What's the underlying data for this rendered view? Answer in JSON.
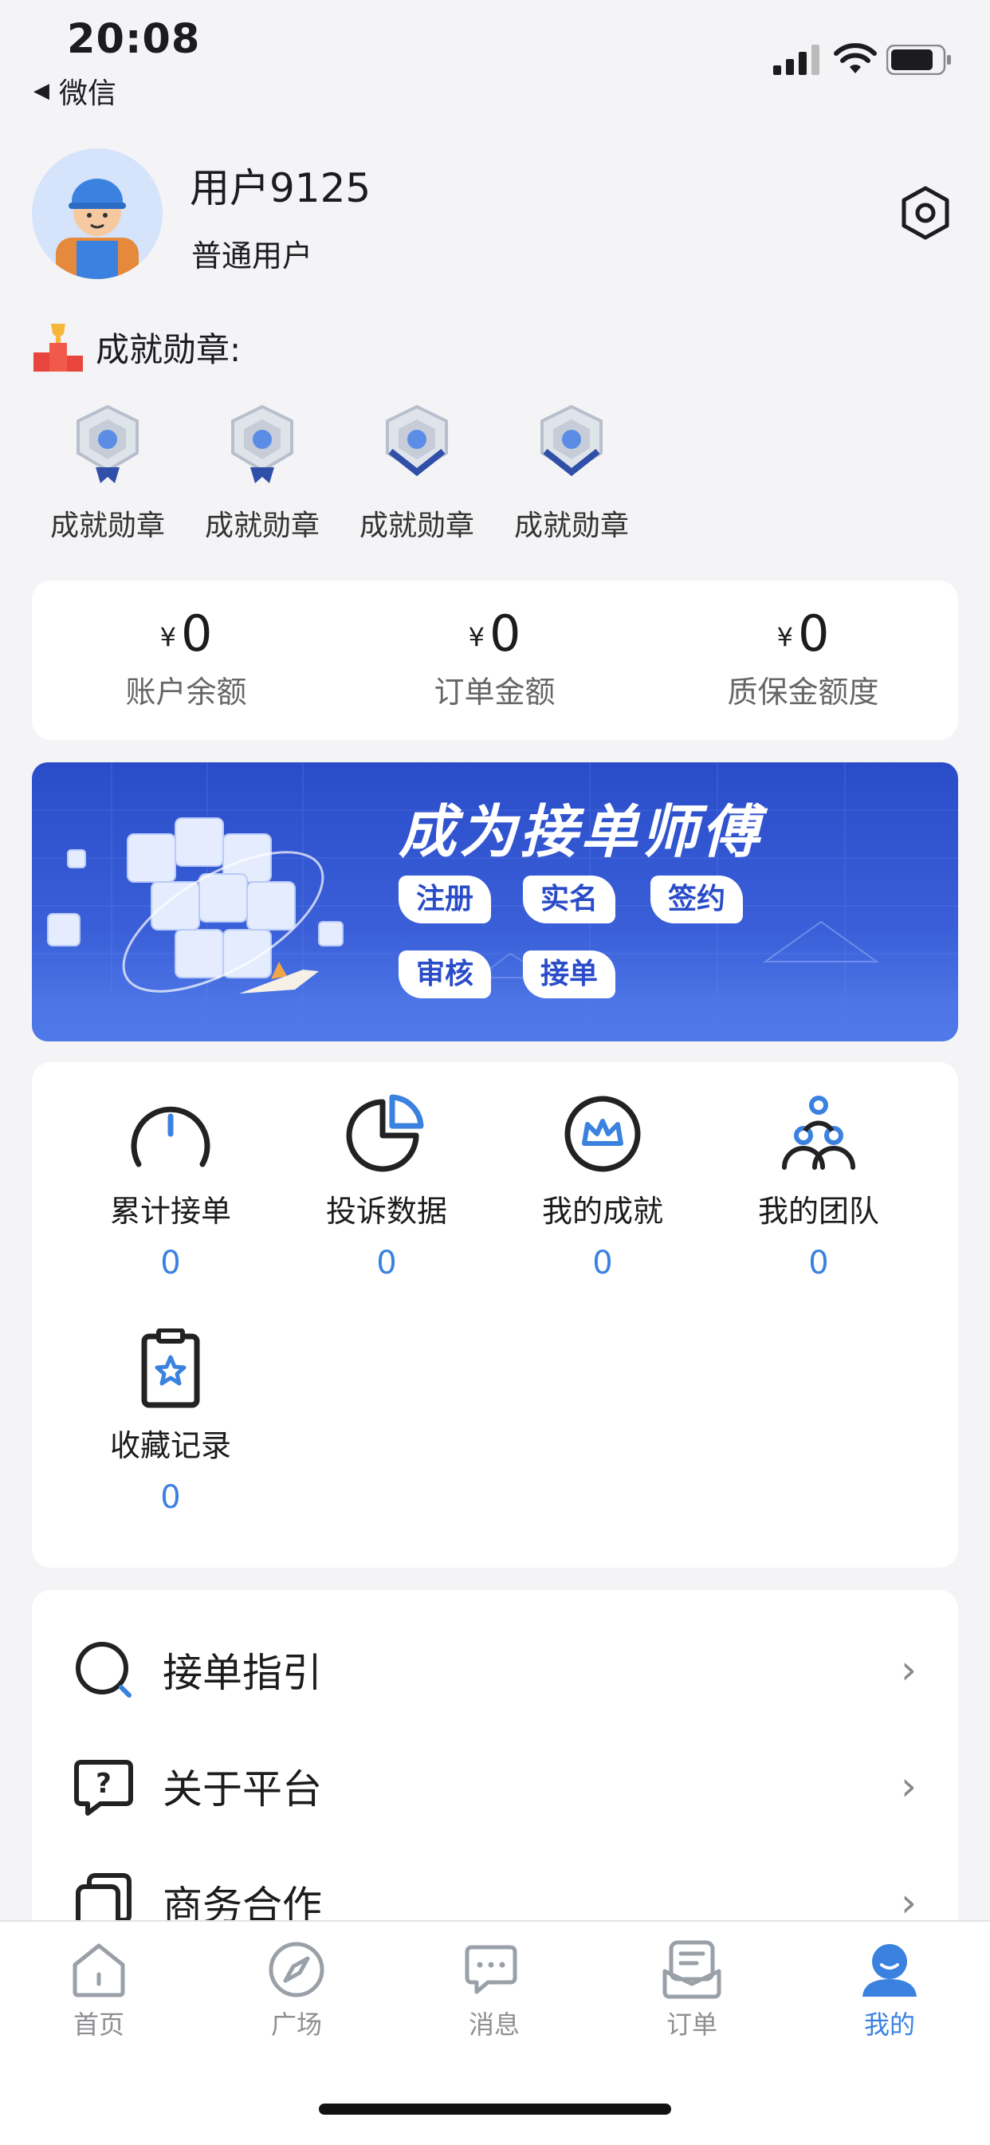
{
  "status_bar": {
    "time": "20:08",
    "back_label": "微信"
  },
  "profile": {
    "username": "用户9125",
    "role": "普通用户"
  },
  "medals": {
    "title": "成就勋章:",
    "items": [
      {
        "label": "成就勋章"
      },
      {
        "label": "成就勋章"
      },
      {
        "label": "成就勋章"
      },
      {
        "label": "成就勋章"
      }
    ]
  },
  "stats": [
    {
      "currency": "¥",
      "value": "0",
      "label": "账户余额"
    },
    {
      "currency": "¥",
      "value": "0",
      "label": "订单金额"
    },
    {
      "currency": "¥",
      "value": "0",
      "label": "质保金额度"
    }
  ],
  "banner": {
    "title": "成为接单师傅",
    "steps": [
      "注册",
      "实名",
      "签约",
      "审核",
      "接单"
    ]
  },
  "features": [
    {
      "label": "累计接单",
      "count": "0",
      "icon": "gauge-icon"
    },
    {
      "label": "投诉数据",
      "count": "0",
      "icon": "pie-chart-icon"
    },
    {
      "label": "我的成就",
      "count": "0",
      "icon": "crown-icon"
    },
    {
      "label": "我的团队",
      "count": "0",
      "icon": "team-icon"
    },
    {
      "label": "收藏记录",
      "count": "0",
      "icon": "clipboard-star-icon"
    }
  ],
  "menu": [
    {
      "label": "接单指引",
      "icon": "search-icon"
    },
    {
      "label": "关于平台",
      "icon": "question-chat-icon"
    },
    {
      "label": "商务合作",
      "icon": "copy-icon"
    }
  ],
  "tabs": [
    {
      "label": "首页",
      "icon": "home-icon"
    },
    {
      "label": "广场",
      "icon": "compass-icon"
    },
    {
      "label": "消息",
      "icon": "message-icon"
    },
    {
      "label": "订单",
      "icon": "order-icon"
    },
    {
      "label": "我的",
      "icon": "profile-icon",
      "active": true
    }
  ],
  "colors": {
    "accent": "#3b82e0",
    "banner": "#2a4cc9",
    "background": "#f4f4f6"
  }
}
